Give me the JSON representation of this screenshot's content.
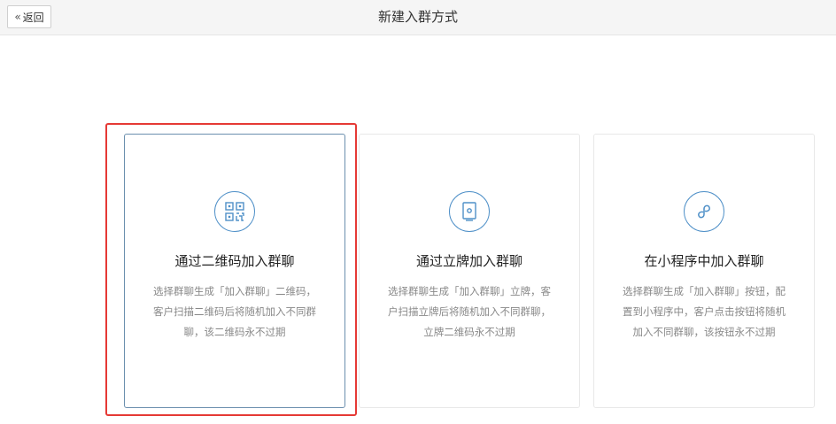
{
  "header": {
    "back_label": "返回",
    "title": "新建入群方式"
  },
  "colors": {
    "accent": "#4f90c8",
    "highlight": "#e53935",
    "muted_text": "#888888"
  },
  "cards": [
    {
      "icon": "qr-code-icon",
      "title": "通过二维码加入群聊",
      "description": "选择群聊生成「加入群聊」二维码，客户扫描二维码后将随机加入不同群聊，该二维码永不过期"
    },
    {
      "icon": "stand-icon",
      "title": "通过立牌加入群聊",
      "description": "选择群聊生成「加入群聊」立牌，客户扫描立牌后将随机加入不同群聊，立牌二维码永不过期"
    },
    {
      "icon": "mini-program-icon",
      "title": "在小程序中加入群聊",
      "description": "选择群聊生成「加入群聊」按钮，配置到小程序中，客户点击按钮将随机加入不同群聊，该按钮永不过期"
    }
  ]
}
